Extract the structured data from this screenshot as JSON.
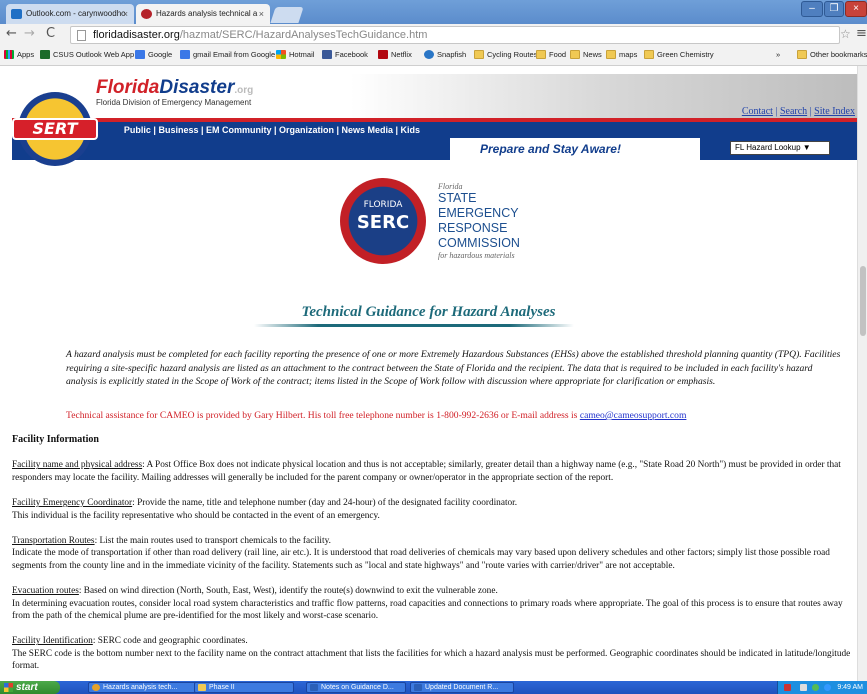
{
  "browser": {
    "tabs": [
      {
        "title": "Outlook.com - carynwoodho",
        "active": false
      },
      {
        "title": "Hazards analysis technical a",
        "active": true
      }
    ],
    "url_host": "floridadisaster.org",
    "url_path": "/hazmat/SERC/HazardAnalysesTechGuidance.htm",
    "bookmarks": [
      "Apps",
      "CSUS Outlook Web App",
      "Google",
      "gmail Email from Google",
      "Hotmail",
      "Facebook",
      "Netflix",
      "Snapfish",
      "Cycling Routes",
      "Food",
      "News",
      "maps",
      "Green Chemistry"
    ],
    "bookmarks_overflow": "»",
    "other_bookmarks": "Other bookmarks"
  },
  "site": {
    "brand_florida": "Florida",
    "brand_disaster": "Disaster",
    "brand_org": ".org",
    "brand_sub": "Florida Division of Emergency Management",
    "logo_text": "SERT",
    "top_links": [
      "Contact",
      "Search",
      "Site Index"
    ],
    "top_link_sep": " | ",
    "nav": "Public | Business | EM Community | Organization | News Media | Kids",
    "slogan": "Prepare and Stay Aware!",
    "hazard_lookup": "FL Hazard Lookup ▼"
  },
  "serc": {
    "logo_top": "FLORIDA",
    "logo_big": "SERC",
    "florida": "Florida",
    "lines": [
      "STATE",
      "EMERGENCY",
      "RESPONSE",
      "COMMISSION"
    ],
    "tagline": "for hazardous materials"
  },
  "document": {
    "title": "Technical Guidance for Hazard Analyses",
    "intro": "A hazard analysis must be completed for each facility reporting the presence of one or more Extremely Hazardous Substances (EHSs) above the established threshold planning quantity (TPQ). Facilities requiring a site-specific hazard analysis are listed as an attachment to the contract between the State of Florida and the recipient. The data that is required to be included in each facility's hazard analysis is explicitly stated in the Scope of Work of the contract; items listed in the Scope of Work follow with discussion where appropriate for clarification or emphasis.",
    "tech_assist": "Technical assistance for CAMEO is provided by Gary Hilbert. His toll free telephone number is 1-800-992-2636 or E-mail address is ",
    "tech_email": "cameo@cameosupport.com ",
    "section_heading": "Facility Information",
    "items": [
      {
        "label": "Facility name and physical address",
        "text": ": A Post Office Box does not indicate physical location and thus is not acceptable; similarly, greater detail than a highway name (e.g., \"State Road 20 North\") must be provided in order that responders may locate the facility. Mailing addresses will generally be included for the parent company or owner/operator in the appropriate section of the report."
      },
      {
        "label": "Facility Emergency Coordinator",
        "text": ": Provide the name, title and telephone number (day and 24-hour) of the designated facility coordinator.",
        "extra": "This individual is the facility representative who should be contacted in the event of an emergency."
      },
      {
        "label": "Transportation Routes",
        "text": ": List the main routes used to transport chemicals to the facility.",
        "extra": "Indicate the mode of transportation if other than road delivery (rail line, air etc.). It is understood that road deliveries of chemicals may vary based upon delivery schedules and other factors; simply list those possible road segments from the county line and in the immediate vicinity of the facility. Statements such as \"local and state highways\" and \"route varies with carrier/driver\" are not acceptable."
      },
      {
        "label": "Evacuation routes",
        "text": ": Based on wind direction (North, South, East, West), identify the route(s) downwind to exit the vulnerable zone.",
        "extra": "In determining evacuation routes, consider local road system characteristics and traffic flow patterns, road capacities and connections to primary roads where appropriate. The goal of this process is to ensure that routes away from the path of the chemical plume are pre-identified for the most likely and worst-case scenario."
      },
      {
        "label": "Facility Identification",
        "text": ": SERC code and geographic coordinates.",
        "extra": "The SERC code is the bottom number next to the facility name on the contract attachment that lists the facilities for which a hazard analysis must be performed. Geographic coordinates should be indicated in latitude/longitude format."
      }
    ]
  },
  "taskbar": {
    "start": "start",
    "tasks": [
      "Hazards analysis tech...",
      "Phase II",
      "Notes on Guidance D...",
      "Updated Document R..."
    ],
    "clock": "9:49 AM"
  },
  "colors": {
    "accent_blue": "#113d8c",
    "accent_red": "#d12128",
    "title_teal": "#1d6a7a"
  }
}
